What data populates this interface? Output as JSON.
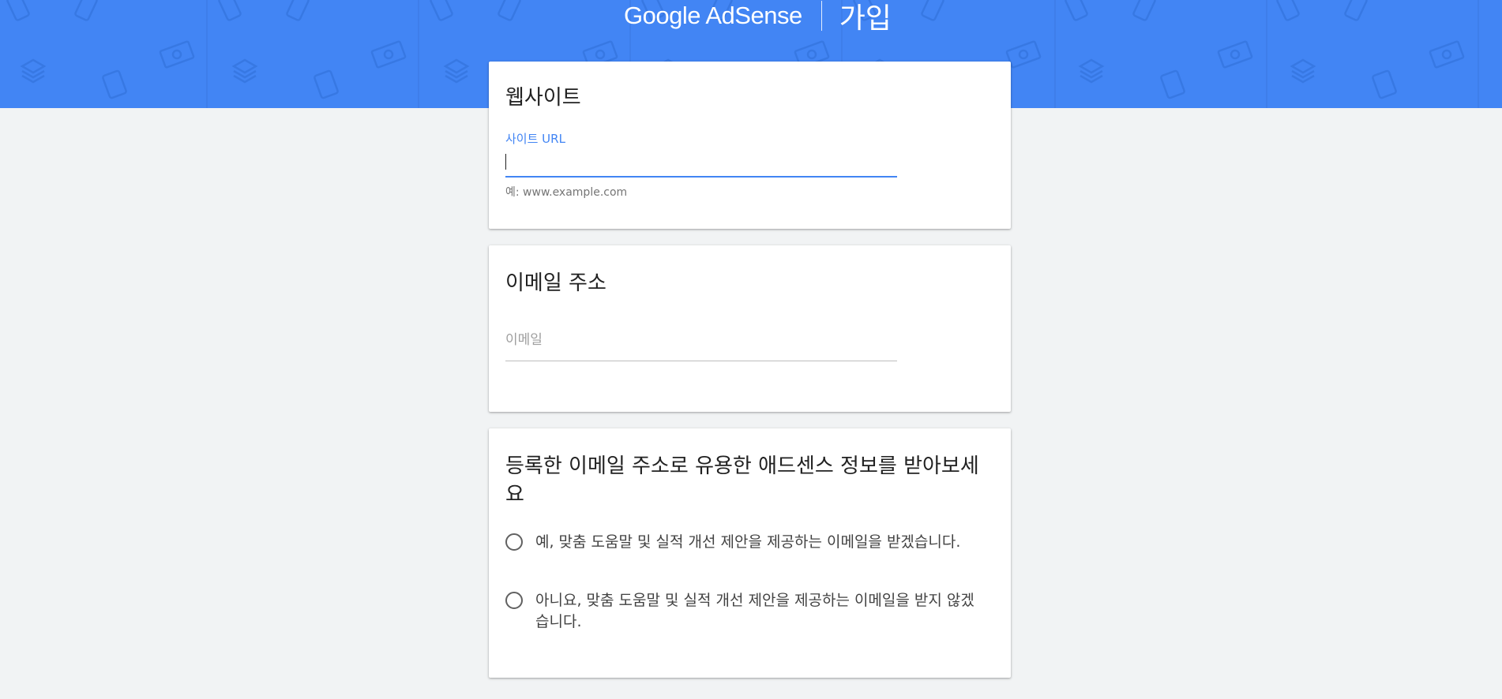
{
  "header": {
    "logo_text": "Google AdSense",
    "page_title": "가입",
    "background_color": "#4285f4"
  },
  "website_card": {
    "title": "웹사이트",
    "url_label": "사이트 URL",
    "url_value": "",
    "url_hint": "예: www.example.com"
  },
  "email_card": {
    "title": "이메일 주소",
    "email_placeholder": "이메일",
    "email_value": ""
  },
  "newsletter_card": {
    "title": "등록한 이메일 주소로 유용한 애드센스 정보를 받아보세요",
    "options": [
      {
        "label": "예, 맞춤 도움말 및 실적 개선 제안을 제공하는 이메일을 받겠습니다.",
        "selected": false
      },
      {
        "label": "아니요, 맞춤 도움말 및 실적 개선 제안을 제공하는 이메일을 받지 않겠습니다.",
        "selected": false
      }
    ]
  },
  "icons": [
    "phone-icon",
    "layers-icon",
    "ad-tag-icon",
    "money-icon"
  ]
}
